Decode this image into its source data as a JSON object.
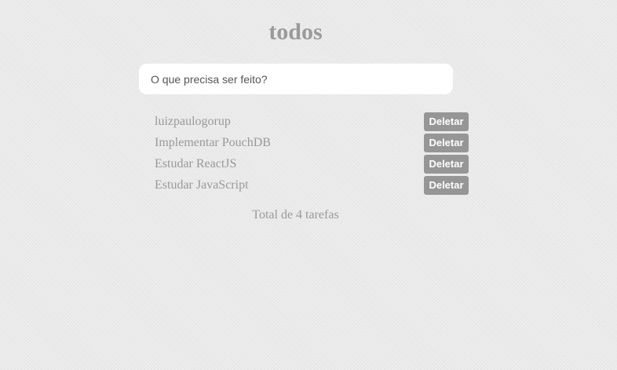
{
  "app": {
    "title": "todos"
  },
  "new_todo": {
    "placeholder": "O que precisa ser feito?",
    "value": ""
  },
  "todos": [
    {
      "label": "luizpaulogorup",
      "delete_label": "Deletar"
    },
    {
      "label": "Implementar PouchDB",
      "delete_label": "Deletar"
    },
    {
      "label": "Estudar ReactJS",
      "delete_label": "Deletar"
    },
    {
      "label": "Estudar JavaScript",
      "delete_label": "Deletar"
    }
  ],
  "footer": {
    "count_text": "Total de 4 tarefas"
  },
  "colors": {
    "background": "#e9e9e9",
    "title": "#9a9a9a",
    "text": "#999999",
    "delete_button": "#969696",
    "delete_button_text": "#ffffff",
    "input_background": "#ffffff"
  }
}
